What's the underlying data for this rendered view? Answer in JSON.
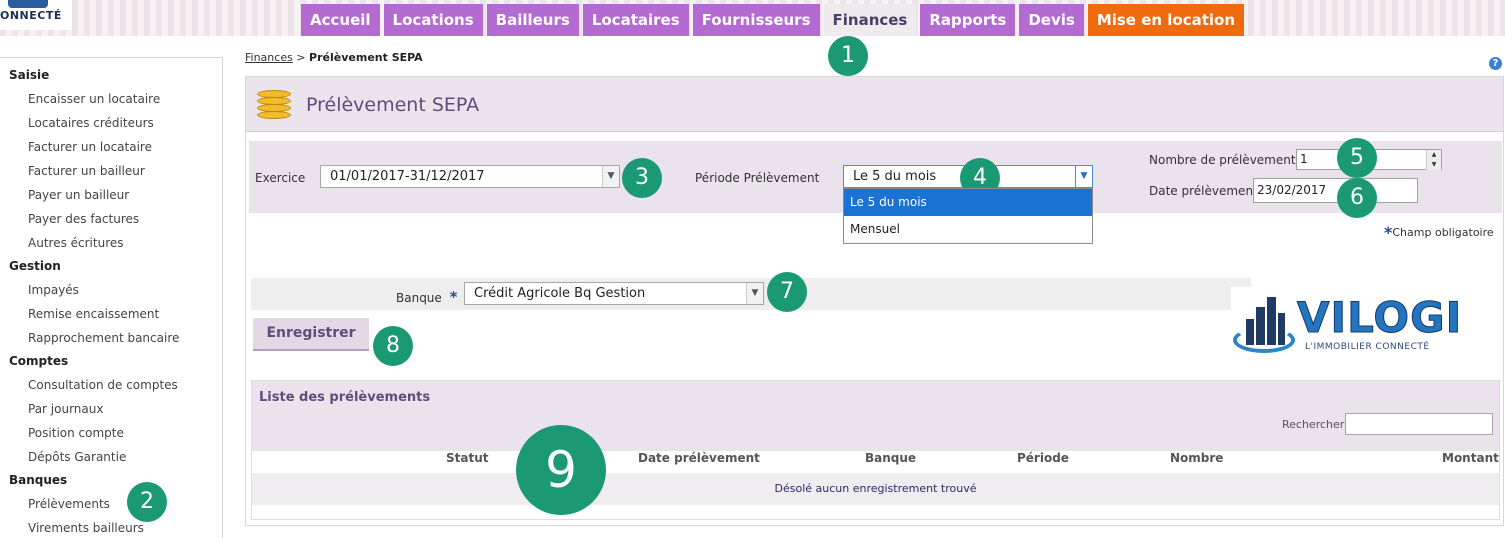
{
  "header": {
    "logo_text": "ONNECTÉ",
    "tabs": [
      {
        "label": "Accueil"
      },
      {
        "label": "Locations"
      },
      {
        "label": "Bailleurs"
      },
      {
        "label": "Locataires"
      },
      {
        "label": "Fournisseurs"
      },
      {
        "label": "Finances"
      },
      {
        "label": "Rapports"
      },
      {
        "label": "Devis"
      },
      {
        "label": "Mise en location"
      }
    ]
  },
  "sidebar": {
    "sections": [
      {
        "title": "Saisie",
        "items": [
          "Encaisser un locataire",
          "Locataires créditeurs",
          "Facturer un locataire",
          "Facturer un bailleur",
          "Payer un bailleur",
          "Payer des factures",
          "Autres écritures"
        ]
      },
      {
        "title": "Gestion",
        "items": [
          "Impayés",
          "Remise encaissement",
          "Rapprochement bancaire"
        ]
      },
      {
        "title": "Comptes",
        "items": [
          "Consultation de comptes",
          "Par journaux",
          "Position compte",
          "Dépôts Garantie"
        ]
      },
      {
        "title": "Banques",
        "items": [
          "Prélèvements",
          "Virements bailleurs"
        ]
      }
    ]
  },
  "breadcrumb": {
    "parent": "Finances",
    "separator": ">",
    "current": "Prélèvement SEPA"
  },
  "help_label": "?",
  "page_title": "Prélèvement SEPA",
  "form": {
    "exercice_label": "Exercice",
    "exercice_value": "01/01/2017-31/12/2017",
    "periode_label": "Période Prélèvement",
    "periode_value": "Le 5 du mois",
    "periode_options": [
      "Le 5 du mois",
      "Mensuel"
    ],
    "nombre_label": "Nombre de prélèvements",
    "nombre_value": "1",
    "date_label": "Date prélèvement",
    "date_value": "23/02/2017",
    "required_star": "*",
    "required_note": "Champ obligatoire",
    "banque_label": "Banque",
    "banque_value": "Crédit Agricole Bq Gestion",
    "save_label": "Enregistrer"
  },
  "brand": {
    "name": "VILOGI",
    "tagline": "L'IMMOBILIER CONNECTÉ"
  },
  "list": {
    "title": "Liste des prélèvements",
    "search_label": "Rechercher",
    "columns": [
      "Statut",
      "Date prélèvement",
      "Banque",
      "Période",
      "Nombre",
      "Montant"
    ],
    "empty_message": "Désolé aucun enregistrement trouvé"
  },
  "badges": [
    "1",
    "2",
    "3",
    "4",
    "5",
    "6",
    "7",
    "8",
    "9"
  ],
  "colors": {
    "tab": "#b36ad1",
    "tab_orange": "#f06a0e",
    "badge": "#1a9973",
    "panel": "#ebe3ec",
    "title": "#5b4f7b"
  }
}
